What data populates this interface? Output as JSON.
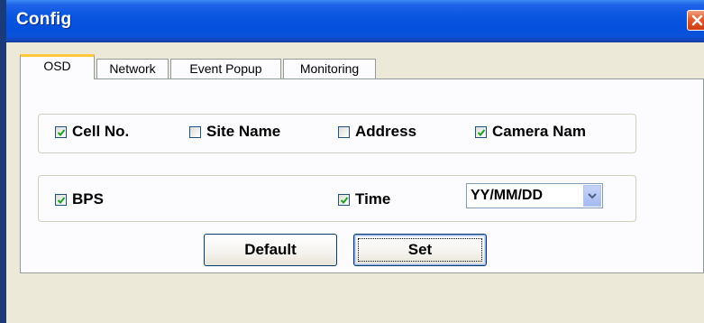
{
  "window": {
    "title": "Config"
  },
  "tabs": [
    {
      "label": "OSD",
      "active": true
    },
    {
      "label": "Network",
      "active": false
    },
    {
      "label": "Event Popup",
      "active": false
    },
    {
      "label": "Monitoring",
      "active": false
    }
  ],
  "osd": {
    "row1": [
      {
        "label": "Cell No.",
        "checked": true
      },
      {
        "label": "Site Name",
        "checked": false
      },
      {
        "label": "Address",
        "checked": false
      },
      {
        "label": "Camera Nam",
        "checked": true
      }
    ],
    "row2": [
      {
        "label": "BPS",
        "checked": true
      },
      {
        "label": "Time",
        "checked": true
      }
    ],
    "date_format": {
      "selected": "YY/MM/DD"
    }
  },
  "buttons": {
    "default_label": "Default",
    "set_label": "Set"
  },
  "icons": {
    "close": "close-icon",
    "check": "checkmark-icon",
    "dropdown": "chevron-down-icon"
  },
  "colors": {
    "titlebar": "#0a56e0",
    "check": "#21a121",
    "tab_accent": "#ffc83c"
  }
}
